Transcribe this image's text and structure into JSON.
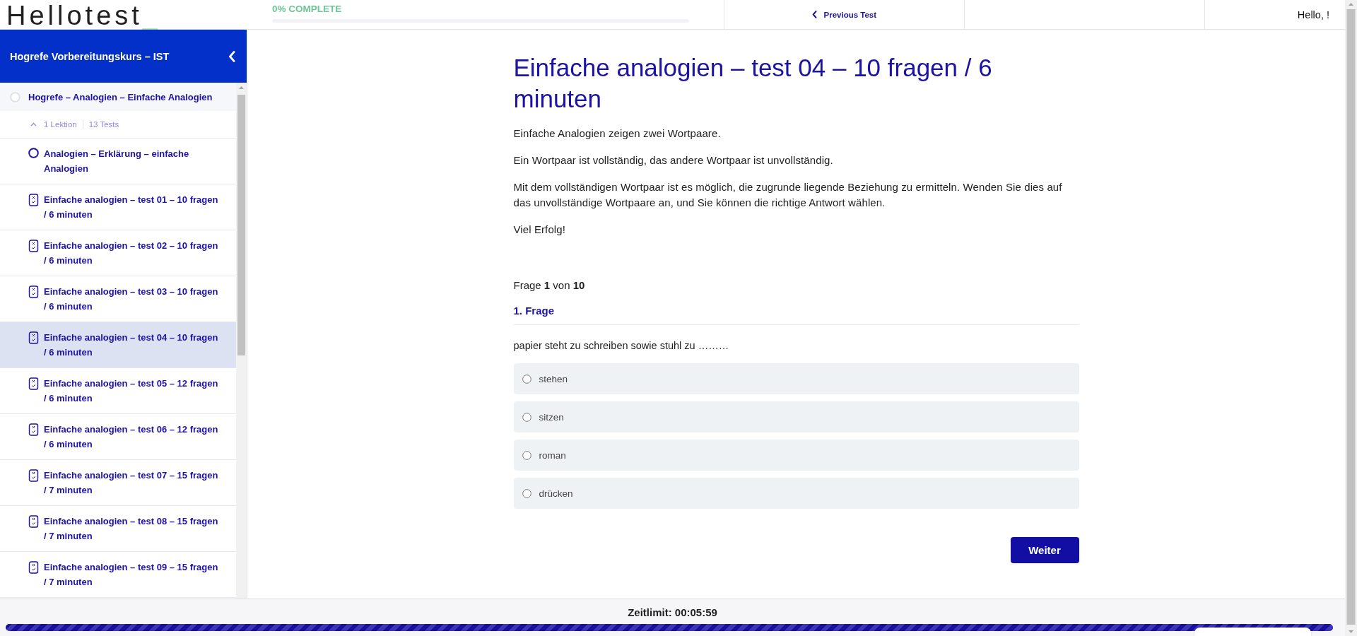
{
  "header": {
    "logo": {
      "text": "Hellotest",
      "mark": "_"
    },
    "progress": {
      "label": "0% COMPLETE"
    },
    "previous_link": "Previous Test",
    "greeting": "Hello, !"
  },
  "sidebar": {
    "title": "Hogrefe Vorbereitungskurs – IST",
    "section": {
      "title": "Hogrefe – Analogien – Einfache Analogien",
      "expanded": true,
      "lessons": "1 Lektion",
      "tests": "13 Tests",
      "items": [
        {
          "kind": "lesson",
          "title": "Analogien – Erklärung – einfache Analogien",
          "selected": false
        },
        {
          "kind": "test",
          "title": "Einfache analogien – test 01 – 10 fragen / 6 minuten",
          "selected": false
        },
        {
          "kind": "test",
          "title": "Einfache analogien – test 02 – 10 fragen / 6 minuten",
          "selected": false
        },
        {
          "kind": "test",
          "title": "Einfache analogien – test 03 – 10 fragen / 6 minuten",
          "selected": false
        },
        {
          "kind": "test",
          "title": "Einfache analogien – test 04 – 10 fragen / 6 minuten",
          "selected": true
        },
        {
          "kind": "test",
          "title": "Einfache analogien – test 05 – 12 fragen / 6 minuten",
          "selected": false
        },
        {
          "kind": "test",
          "title": "Einfache analogien – test 06 – 12 fragen / 6 minuten",
          "selected": false
        },
        {
          "kind": "test",
          "title": "Einfache analogien – test 07 – 15 fragen / 7 minuten",
          "selected": false
        },
        {
          "kind": "test",
          "title": "Einfache analogien – test 08 – 15 fragen / 7 minuten",
          "selected": false
        },
        {
          "kind": "test",
          "title": "Einfache analogien – test 09 – 15 fragen / 7 minuten",
          "selected": false
        }
      ]
    }
  },
  "content": {
    "title": "Einfache analogien – test 04 – 10 fragen / 6 minuten",
    "intro": [
      "Einfache Analogien zeigen zwei Wortpaare.",
      "Ein Wortpaar ist vollständig, das andere Wortpaar ist unvollständig.",
      "Mit dem vollständigen Wortpaar ist es möglich, die zugrunde liegende Beziehung zu ermitteln. Wenden Sie dies auf das unvollständige Wortpaare an, und Sie können die richtige Antwort wählen.",
      "Viel Erfolg!"
    ],
    "counter": "Frage **1** von **10**",
    "question_title": "1. Frage",
    "question": "papier steht zu schreiben sowie stuhl zu ………",
    "options": [
      {
        "label": "stehen",
        "selected": false
      },
      {
        "label": "sitzen",
        "selected": false
      },
      {
        "label": "roman",
        "selected": false
      },
      {
        "label": "drücken",
        "selected": false
      }
    ],
    "next_button": "Weiter"
  },
  "footer": {
    "timer": "Zeitlimit: 00:05:59",
    "time_bar": {
      "level": 1
    }
  }
}
